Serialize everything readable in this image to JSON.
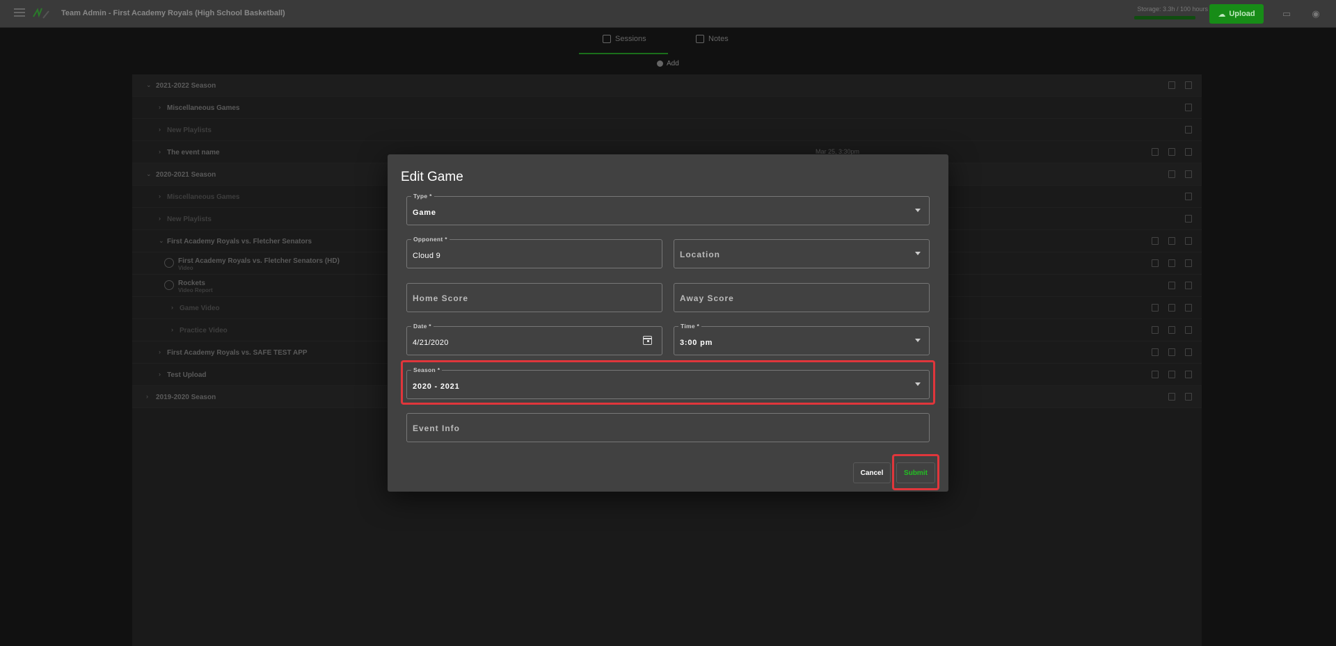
{
  "topbar": {
    "title": "Team Admin - First Academy Royals (High School Basketball)",
    "storage_text": "Storage: 3.3h / 100 hours",
    "upload_label": "Upload"
  },
  "tabs": [
    {
      "label": "Sessions"
    },
    {
      "label": "Notes"
    }
  ],
  "add_label": "Add",
  "list": {
    "rows": [
      {
        "label": "2021-2022 Season",
        "kind": "season"
      },
      {
        "label": "Miscellaneous Games",
        "kind": "item"
      },
      {
        "label": "New Playlists",
        "kind": "item-dim"
      },
      {
        "label": "The event name",
        "kind": "item",
        "date": "Mar 25, 3:30pm"
      },
      {
        "label": "2020-2021 Season",
        "kind": "season"
      },
      {
        "label": "Miscellaneous Games",
        "kind": "item-dim"
      },
      {
        "label": "New Playlists",
        "kind": "item-dim"
      },
      {
        "label": "First Academy Royals vs. Fletcher Senators",
        "kind": "item"
      },
      {
        "label": "First Academy Royals vs. Fletcher Senators (HD)",
        "kind": "video",
        "sub": "Video"
      },
      {
        "label": "Rockets",
        "kind": "video",
        "sub": "Video Report"
      },
      {
        "label": "Game Video",
        "kind": "sub-dim"
      },
      {
        "label": "Practice Video",
        "kind": "sub-dim"
      },
      {
        "label": "First Academy Royals vs. SAFE TEST APP",
        "kind": "item"
      },
      {
        "label": "Test Upload",
        "kind": "item"
      },
      {
        "label": "2019-2020 Season",
        "kind": "season"
      }
    ]
  },
  "dialog": {
    "title": "Edit Game",
    "type": {
      "label": "Type *",
      "value": "Game"
    },
    "opponent": {
      "label": "Opponent *",
      "value": "Cloud 9"
    },
    "location": {
      "placeholder": "Location"
    },
    "home_score": {
      "placeholder": "Home Score"
    },
    "away_score": {
      "placeholder": "Away Score"
    },
    "date": {
      "label": "Date *",
      "value": "4/21/2020"
    },
    "time": {
      "label": "Time *",
      "value": "3:00 pm"
    },
    "season": {
      "label": "Season *",
      "value": "2020 - 2021"
    },
    "event_info": {
      "placeholder": "Event Info"
    },
    "cancel_label": "Cancel",
    "submit_label": "Submit"
  },
  "colors": {
    "accent": "#178c17",
    "highlight": "#e0363b",
    "dialog_bg": "#414141"
  }
}
